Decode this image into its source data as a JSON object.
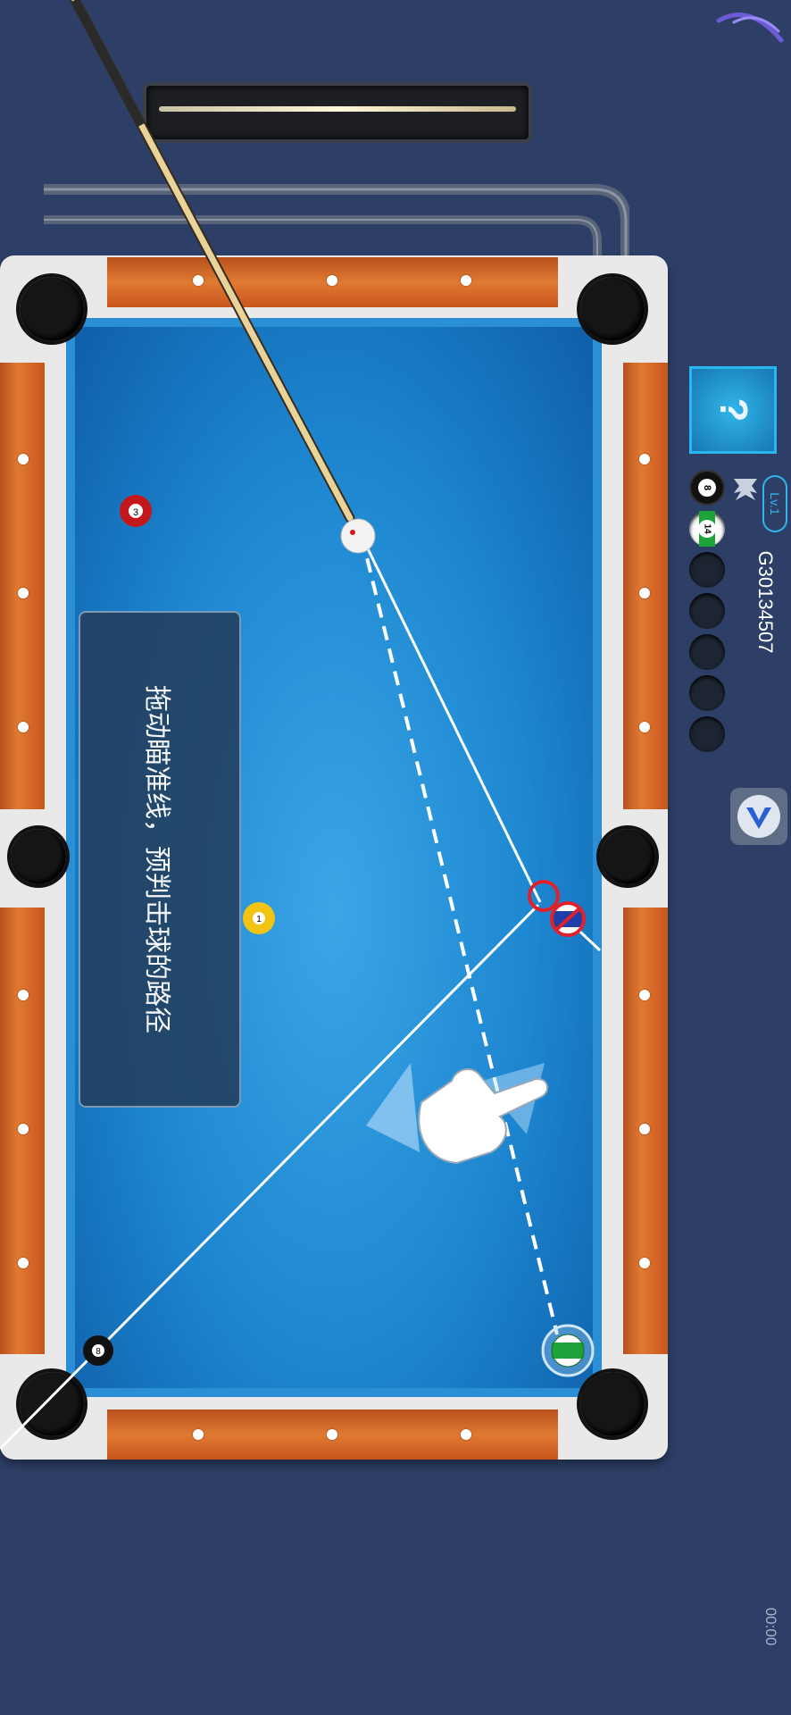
{
  "tutorial": {
    "text": "拖动瞄准线，预判击球的路径"
  },
  "player": {
    "id": "G30134507",
    "level": "Lv.1",
    "avatar_label": "?",
    "ball_slots": [
      {
        "number": "8",
        "color": "#111111",
        "stripe": false,
        "filled": true
      },
      {
        "number": "14",
        "color": "#1ea33a",
        "stripe": true,
        "filled": true
      },
      {
        "number": "",
        "filled": false
      },
      {
        "number": "",
        "filled": false
      },
      {
        "number": "",
        "filled": false
      },
      {
        "number": "",
        "filled": false
      },
      {
        "number": "",
        "filled": false
      }
    ]
  },
  "table_balls": [
    {
      "name": "ball-3",
      "number": "3",
      "color": "#c4171b",
      "stripe": false
    },
    {
      "name": "cue-ball",
      "number": "",
      "color": "#f2f2f2",
      "stripe": false
    },
    {
      "name": "ball-1",
      "number": "1",
      "color": "#f2c313",
      "stripe": false
    },
    {
      "name": "ball-10",
      "number": "10",
      "color": "#1d3fa8",
      "stripe": true
    },
    {
      "name": "ball-8",
      "number": "8",
      "color": "#111111",
      "stripe": false
    },
    {
      "name": "ball-14",
      "number": "14",
      "color": "#1ea33a",
      "stripe": true
    }
  ],
  "timer": {
    "text": "00:00"
  },
  "colors": {
    "background": "#2d3f66",
    "cloth": "#1d86d0",
    "rail_wood": "#d86a28",
    "accent": "#29b7ee"
  },
  "icons": {
    "settings": "v-logo-icon",
    "crown": "crown-icon",
    "pointer": "hand-pointer-icon"
  }
}
